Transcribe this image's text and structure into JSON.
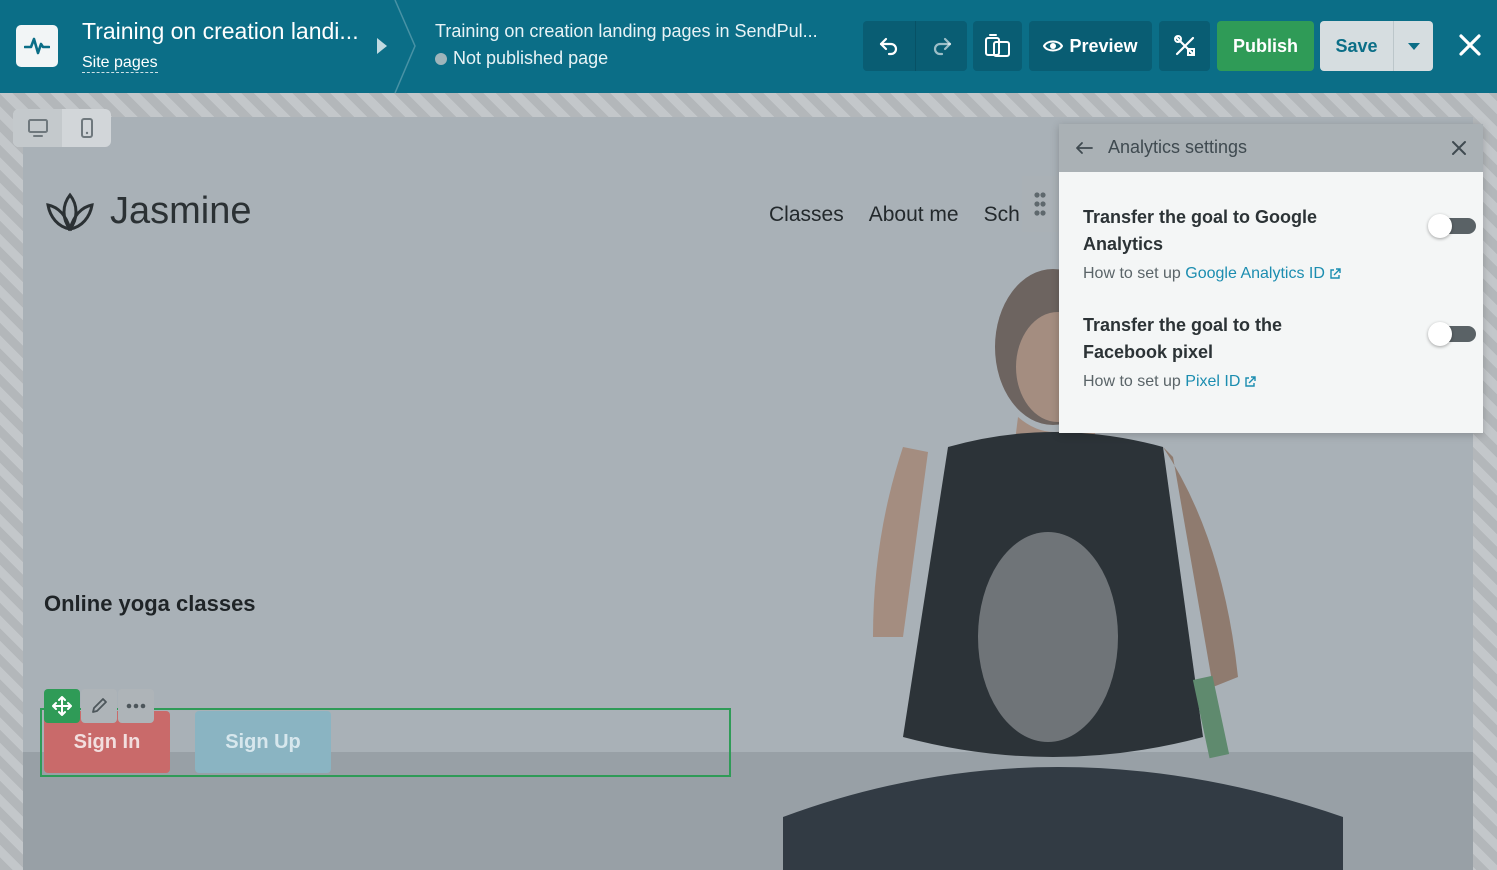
{
  "editor": {
    "site_title": "Training on creation landi...",
    "site_pages_link": "Site pages",
    "page_title": "Training on creation landing pages in SendPul...",
    "page_status": "Not published page",
    "preview_label": "Preview",
    "publish_label": "Publish",
    "save_label": "Save"
  },
  "landing": {
    "brand_name": "Jasmine",
    "nav": [
      "Classes",
      "About me",
      "Sch"
    ],
    "hero_title": "Online yoga classes",
    "sign_in_label": "Sign In",
    "sign_up_label": "Sign Up"
  },
  "analytics_panel": {
    "title": "Analytics settings",
    "settings": [
      {
        "label": "Transfer the goal to Google Analytics",
        "help_prefix": "How to set up ",
        "help_link": "Google Analytics ID",
        "enabled": false
      },
      {
        "label": "Transfer the goal to the Facebook pixel",
        "help_prefix": "How to set up ",
        "help_link": "Pixel ID",
        "enabled": false
      }
    ]
  },
  "colors": {
    "topbar": "#0b6e87",
    "publish": "#2f9b57",
    "link": "#1b8db0",
    "selection_outline": "#2f9b57"
  },
  "icons": [
    "pulse-logo-icon",
    "undo-icon",
    "redo-icon",
    "files-icon",
    "eye-icon",
    "tools-icon",
    "close-icon",
    "desktop-icon",
    "mobile-icon",
    "lotus-icon",
    "drag-dots-icon",
    "move-icon",
    "pencil-icon",
    "more-icon",
    "arrow-left-icon",
    "external-link-icon"
  ]
}
